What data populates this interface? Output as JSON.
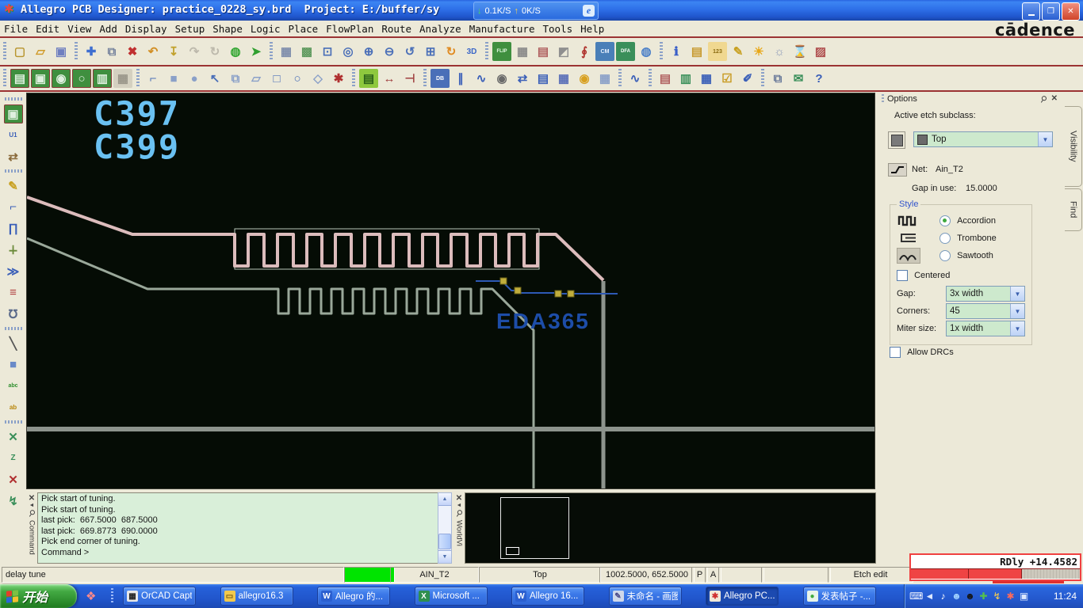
{
  "window": {
    "title": "Allegro PCB Designer: practice_0228_sy.brd  Project: E:/buffer/sy",
    "traffic": {
      "down_arrow": "↓",
      "down": "0.1K/S",
      "up_arrow": "↑",
      "up": "0K/S",
      "ie": "e"
    },
    "brand": "cādence",
    "buttons": {
      "minimize": "",
      "restore": "❐",
      "close": "✕"
    }
  },
  "menu": {
    "items": [
      "File",
      "Edit",
      "View",
      "Add",
      "Display",
      "Setup",
      "Shape",
      "Logic",
      "Place",
      "FlowPlan",
      "Route",
      "Analyze",
      "Manufacture",
      "Tools",
      "Help"
    ]
  },
  "toolbar_row1": {
    "icons": [
      {
        "n": "new-drawing",
        "g": "▢",
        "c": "#b8952e"
      },
      {
        "n": "open-drawing",
        "g": "▱",
        "c": "#d09a28"
      },
      {
        "n": "save-drawing",
        "g": "▣",
        "c": "#6f7fc0"
      },
      "|",
      {
        "n": "move",
        "g": "✚",
        "c": "#3f6fd0"
      },
      {
        "n": "copy",
        "g": "⧉",
        "c": "#76839d"
      },
      {
        "n": "delete",
        "g": "✖",
        "c": "#c03030"
      },
      {
        "n": "undo",
        "g": "↶",
        "c": "#d28f25"
      },
      {
        "n": "pour",
        "g": "↧",
        "c": "#c2a22e"
      },
      {
        "n": "redo-disabled",
        "g": "↷",
        "c": "#bdb9ac"
      },
      {
        "n": "rotate-disabled",
        "g": "↻",
        "c": "#bdb9ac"
      },
      {
        "n": "shove",
        "g": "◍",
        "c": "#2fa52f"
      },
      {
        "n": "fix-pin",
        "g": "➤",
        "c": "#2f9f2f"
      },
      "|",
      {
        "n": "unrats-all",
        "g": "▦",
        "c": "#7d8cab"
      },
      {
        "n": "rats-all",
        "g": "▩",
        "c": "#5f9a5f"
      },
      {
        "n": "zoom-points",
        "g": "⊡",
        "c": "#4a6fb8"
      },
      {
        "n": "zoom-fit",
        "g": "◎",
        "c": "#4a6fb8"
      },
      {
        "n": "zoom-in",
        "g": "⊕",
        "c": "#4a6fb8"
      },
      {
        "n": "zoom-out",
        "g": "⊖",
        "c": "#4a6fb8"
      },
      {
        "n": "zoom-previous",
        "g": "↺",
        "c": "#4a6fb8"
      },
      {
        "n": "zoom-selection",
        "g": "⊞",
        "c": "#4a6fb8"
      },
      {
        "n": "redraw",
        "g": "↻",
        "c": "#e08a20"
      },
      {
        "n": "view-3d",
        "g": "3D",
        "c": "#3a66c8",
        "fs": "10"
      },
      "|",
      {
        "n": "flip-design",
        "g": "FLIP",
        "c": "#e8ffe8",
        "bg": "#3f8f3f",
        "fs": "6"
      },
      {
        "n": "toggle-grid",
        "g": "▦",
        "c": "#8a8a8a"
      },
      {
        "n": "color-dialog",
        "g": "▤",
        "c": "#b06060"
      },
      {
        "n": "shadow-mode",
        "g": "◩",
        "c": "#8f8f8f"
      },
      {
        "n": "assign-color",
        "g": "∮",
        "c": "#b0352f"
      },
      {
        "n": "constraint-manager",
        "g": "CM",
        "c": "#eaf2ff",
        "bg": "#4a7fb8",
        "fs": "7"
      },
      {
        "n": "dfa-check",
        "g": "DFA",
        "c": "#ffffff",
        "bg": "#3a8f5a",
        "fs": "6"
      },
      {
        "n": "status-world",
        "g": "◍",
        "c": "#4a7fc8"
      },
      "|",
      {
        "n": "show-element",
        "g": "ℹ",
        "c": "#3a5fc8"
      },
      {
        "n": "show-constraints",
        "g": "▤",
        "c": "#c89a30"
      },
      {
        "n": "measure",
        "g": "123",
        "c": "#8a6a10",
        "bg": "#f0d890",
        "fs": "7"
      },
      {
        "n": "highlight",
        "g": "✎",
        "c": "#c8a020"
      },
      {
        "n": "shine",
        "g": "☀",
        "c": "#e8a818"
      },
      {
        "n": "dehighlight",
        "g": "☼",
        "c": "#8a98b8"
      },
      {
        "n": "waive-drc",
        "g": "⌛",
        "c": "#2f9f2f"
      },
      {
        "n": "no-drc-pick",
        "g": "▨",
        "c": "#b05050"
      }
    ]
  },
  "toolbar_row2": {
    "icons": [
      {
        "n": "route-keepin",
        "g": "▤",
        "c": "#dff0df",
        "bg": "#3f8f3f",
        "bd": "#8a3a3a"
      },
      {
        "n": "route-keepout",
        "g": "▣",
        "c": "#dff0df",
        "bg": "#3f8f3f",
        "bd": "#8a3a3a"
      },
      {
        "n": "via-keepout",
        "g": "◉",
        "c": "#dff0df",
        "bg": "#3f8f3f",
        "bd": "#8a3a3a"
      },
      {
        "n": "package-keepin",
        "g": "○",
        "c": "#dff0df",
        "bg": "#3f8f3f",
        "bd": "#8a3a3a"
      },
      {
        "n": "package-keepout",
        "g": "▥",
        "c": "#dff0df",
        "bg": "#3f8f3f",
        "bd": "#8a3a3a"
      },
      {
        "n": "shape-disabled",
        "g": "▦",
        "c": "#9a968a",
        "bg": "#d4d0c0"
      },
      "|",
      {
        "n": "shape-add",
        "g": "⌐",
        "c": "#4a6fb8"
      },
      {
        "n": "shape-rect",
        "g": "■",
        "c": "#8aa0c8"
      },
      {
        "n": "shape-circle",
        "g": "●",
        "c": "#8aa0c8"
      },
      {
        "n": "shape-select",
        "g": "↖",
        "c": "#4a6fb8"
      },
      {
        "n": "shape-copy",
        "g": "⧉",
        "c": "#8aa0c8"
      },
      {
        "n": "shape-edit-boundary",
        "g": "▱",
        "c": "#8aa0c8"
      },
      {
        "n": "void-rect",
        "g": "□",
        "c": "#4a6fb8"
      },
      {
        "n": "void-circle",
        "g": "○",
        "c": "#4a6fb8"
      },
      {
        "n": "void-poly",
        "g": "◇",
        "c": "#8aa0c8"
      },
      {
        "n": "shape-merge",
        "g": "✱",
        "c": "#b03030"
      },
      "|",
      {
        "n": "padstack-modify",
        "g": "▤",
        "c": "#2a5f1a",
        "bg": "#8ec83e"
      },
      {
        "n": "dimension-linear",
        "g": "↔",
        "c": "#a04040"
      },
      {
        "n": "dimension-datum",
        "g": "⊣",
        "c": "#a04040"
      },
      "|",
      {
        "n": "db-doctor",
        "g": "DB",
        "c": "#ffffff",
        "bg": "#4a6fb8",
        "fs": "7"
      },
      {
        "n": "align-components",
        "g": "∥",
        "c": "#3a5fb8"
      },
      {
        "n": "refresh-symbols",
        "g": "∿",
        "c": "#3a5fb8"
      },
      {
        "n": "snapshot",
        "g": "◉",
        "c": "#6a6a6a"
      },
      {
        "n": "swap-refdes",
        "g": "⇄",
        "c": "#3a5fb8"
      },
      {
        "n": "property-edit",
        "g": "▤",
        "c": "#3a5fb8"
      },
      {
        "n": "pattern-grid",
        "g": "▦",
        "c": "#5a6fb8"
      },
      {
        "n": "spin",
        "g": "◉",
        "c": "#d8a020"
      },
      {
        "n": "replicate",
        "g": "▦",
        "c": "#8aa0c8"
      },
      "|",
      {
        "n": "net-topology",
        "g": "∿",
        "c": "#3a5fb8"
      },
      "|",
      {
        "n": "report-todo",
        "g": "▤",
        "c": "#b06060"
      },
      {
        "n": "design-book",
        "g": "▥",
        "c": "#3a8f5a"
      },
      {
        "n": "drc-browser",
        "g": "▦",
        "c": "#3a5fb8"
      },
      {
        "n": "design-check",
        "g": "☑",
        "c": "#c89a20"
      },
      {
        "n": "probe",
        "g": "✐",
        "c": "#3a5fb8"
      },
      "|",
      {
        "n": "copy-clipboard",
        "g": "⧉",
        "c": "#6a7a9a"
      },
      {
        "n": "export-mail",
        "g": "✉",
        "c": "#3a8f5a"
      },
      {
        "n": "help",
        "g": "?",
        "c": "#3a5fb8"
      }
    ]
  },
  "left_toolbar": {
    "icons": [
      {
        "n": "place-component",
        "g": "▣",
        "c": "#dff0df",
        "bg": "#3f8f3f",
        "bd": "#8a3a3a"
      },
      {
        "n": "place-manual",
        "g": "U1",
        "c": "#3a5fb8",
        "fs": "8"
      },
      {
        "n": "move-component",
        "g": "⇄",
        "c": "#8a6a3a"
      },
      "|",
      {
        "n": "add-connect",
        "g": "✎",
        "c": "#c8a020"
      },
      {
        "n": "slide",
        "g": "⌐",
        "c": "#3a5fb8"
      },
      {
        "n": "delay-tune",
        "g": "∏",
        "c": "#3a5fb8"
      },
      {
        "n": "vertex",
        "g": "∔",
        "c": "#6a8a3a"
      },
      {
        "n": "spread-lines",
        "g": "≫",
        "c": "#3a5fb8"
      },
      {
        "n": "align-objects",
        "g": "≡",
        "c": "#b04040"
      },
      {
        "n": "accordion-loop",
        "g": "℧",
        "c": "#5a6a8a"
      },
      "|",
      {
        "n": "add-line",
        "g": "╲",
        "c": "#555555"
      },
      {
        "n": "add-rect",
        "g": "■",
        "c": "#6a8ac8"
      },
      {
        "n": "add-text",
        "g": "abc",
        "c": "#2f8f2f",
        "fs": "7"
      },
      {
        "n": "edit-text",
        "g": "ab",
        "c": "#b8860b",
        "fs": "8"
      },
      "|",
      {
        "n": "net-schedule",
        "g": "✕",
        "c": "#3a8f5a"
      },
      {
        "n": "net-route",
        "g": "Z",
        "c": "#3a8f5a",
        "fs": "10"
      },
      {
        "n": "net-unroute",
        "g": "✕",
        "c": "#b03030"
      },
      {
        "n": "net-assign",
        "g": "↯",
        "c": "#3a8f5a"
      }
    ]
  },
  "canvas": {
    "ref_des_1": "C397",
    "ref_des_2": "C399",
    "watermark": "EDA365"
  },
  "options": {
    "title": "Options",
    "active_etch_label": "Active etch subclass:",
    "subclass": "Top",
    "net_label": "Net:",
    "net_name": "Ain_T2",
    "gap_label": "Gap in use:",
    "gap_value": "15.0000",
    "style_legend": "Style",
    "styles": [
      {
        "label": "Accordion",
        "selected": true
      },
      {
        "label": "Trombone",
        "selected": false
      },
      {
        "label": "Sawtooth",
        "selected": false
      }
    ],
    "centered_label": "Centered",
    "gap_field_label": "Gap:",
    "gap_field_value": "3x width",
    "corners_label": "Corners:",
    "corners_value": "45",
    "miter_label": "Miter size:",
    "miter_value": "1x width",
    "allow_drcs_label": "Allow DRCs",
    "side_tabs": [
      "Visibility",
      "Find"
    ]
  },
  "console": {
    "strip": "Command",
    "lines": [
      "Pick start of tuning.",
      "Pick start of tuning.",
      "last pick:  667.5000  687.5000",
      "last pick:  669.8773  690.0000",
      "Pick end corner of tuning.",
      "Command >"
    ]
  },
  "worldview": {
    "strip": "WorldVi"
  },
  "delay_meter": {
    "readout": "RDly +14.4582"
  },
  "status": {
    "command": "delay tune",
    "net": "AIN_T2",
    "layer": "Top",
    "coords": "1002.5000, 652.5000",
    "pick": "P",
    "angle": "A",
    "mode": "Etch edit"
  },
  "taskbar": {
    "start": "开始",
    "tasks": [
      {
        "label": "OrCAD Capt...",
        "icon": "orcad",
        "glyph": "▦",
        "ic": "#e8e8e8",
        "tc": "#222222",
        "active": false
      },
      {
        "label": "allegro16.3",
        "icon": "folder",
        "glyph": "▭",
        "ic": "#f2c94c",
        "tc": "#7a5a10",
        "active": false
      },
      {
        "label": "Allegro 的...",
        "icon": "word",
        "glyph": "W",
        "ic": "#2b5fd0",
        "tc": "#ffffff",
        "active": false
      },
      {
        "label": "Microsoft ...",
        "icon": "excel",
        "glyph": "X",
        "ic": "#2e8f4e",
        "tc": "#ffffff",
        "active": false
      },
      {
        "label": "Allegro 16...",
        "icon": "word",
        "glyph": "W",
        "ic": "#2b5fd0",
        "tc": "#ffffff",
        "active": false
      },
      {
        "label": "未命名 - 画图",
        "icon": "paint",
        "glyph": "✎",
        "ic": "#cfd8ea",
        "tc": "#4a4a8a",
        "active": false
      },
      {
        "label": "Allegro PC...",
        "icon": "allegro",
        "glyph": "✱",
        "ic": "#f0e8d8",
        "tc": "#d03030",
        "active": true
      },
      {
        "label": "发表帖子 -...",
        "icon": "browser",
        "glyph": "●",
        "ic": "#e8f4e8",
        "tc": "#3faa3f",
        "active": false
      }
    ],
    "tray": [
      {
        "n": "keyboard-icon",
        "g": "⌨",
        "c": "#f0f4ff"
      },
      {
        "n": "collapse-arrow-icon",
        "g": "◄",
        "c": "#dce8ff"
      },
      {
        "n": "volume-icon",
        "g": "♪",
        "c": "#ffffff"
      },
      {
        "n": "messenger-icon",
        "g": "☻",
        "c": "#9fd0ff"
      },
      {
        "n": "qq-icon",
        "g": "☻",
        "c": "#141414"
      },
      {
        "n": "antivirus-shield-icon",
        "g": "✚",
        "c": "#56c24a"
      },
      {
        "n": "thunder-icon",
        "g": "↯",
        "c": "#ffd24a"
      },
      {
        "n": "security-alert-icon",
        "g": "✱",
        "c": "#ff6a5a"
      },
      {
        "n": "display-icon",
        "g": "▣",
        "c": "#dce8ff"
      }
    ],
    "clock": "11:24"
  }
}
